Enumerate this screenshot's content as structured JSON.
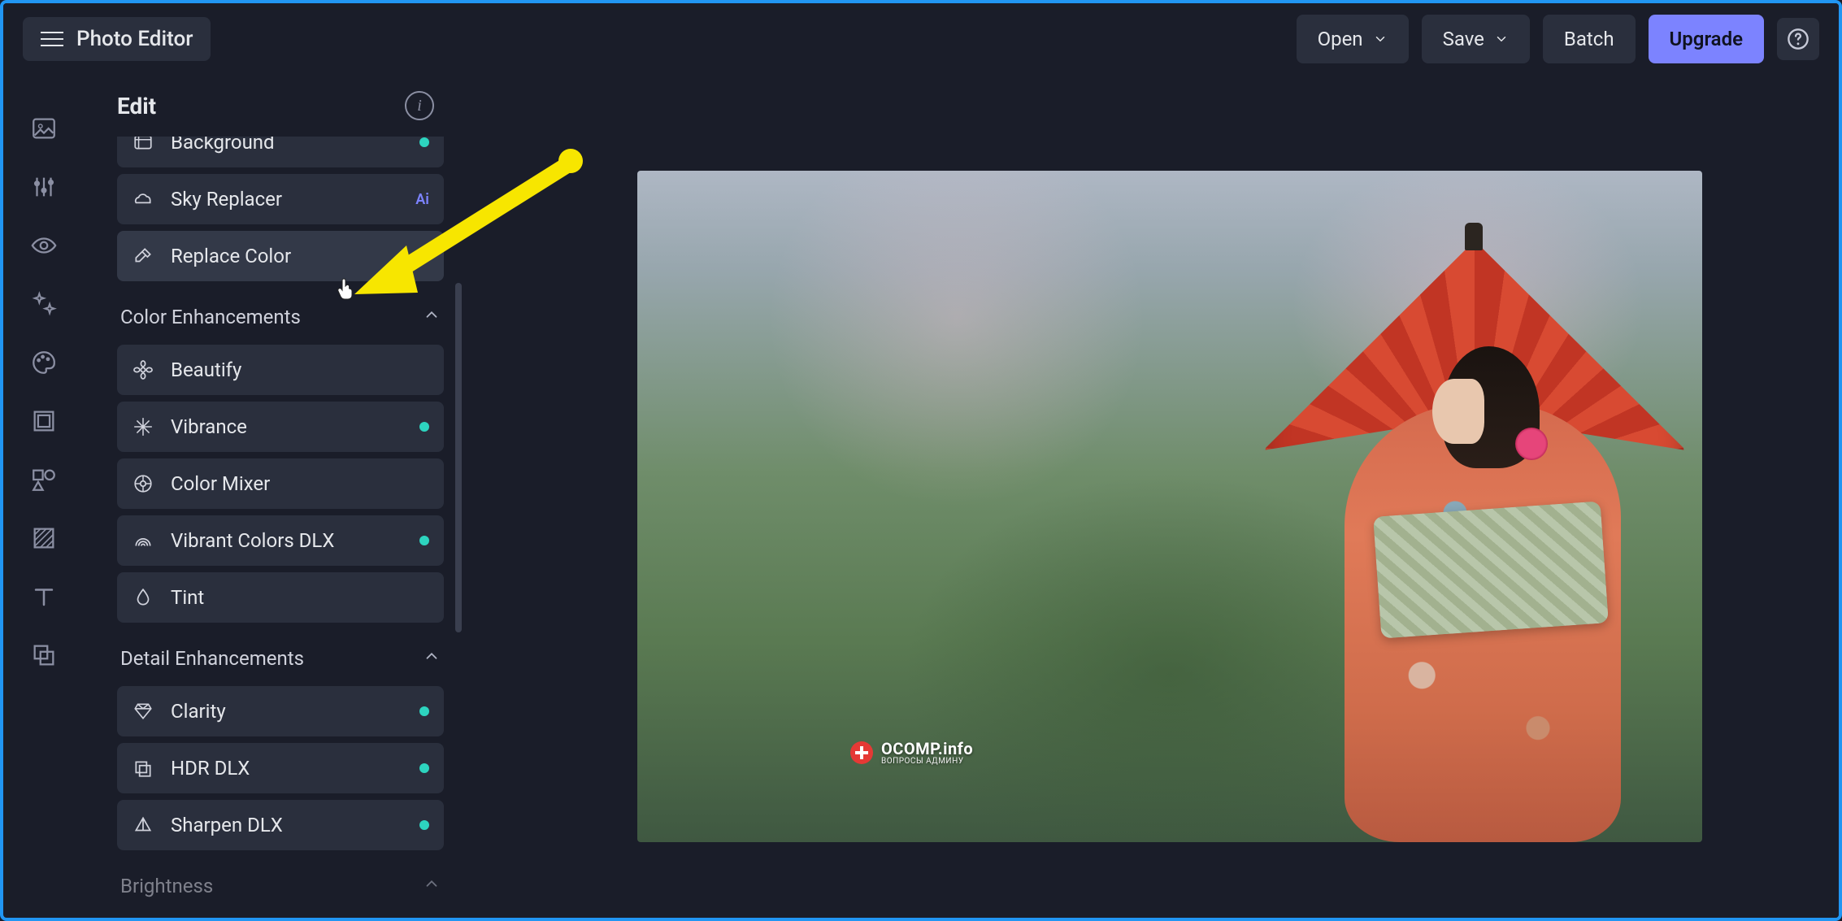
{
  "header": {
    "app_title": "Photo Editor",
    "open_label": "Open",
    "save_label": "Save",
    "batch_label": "Batch",
    "upgrade_label": "Upgrade"
  },
  "panel": {
    "title": "Edit",
    "tools_top": [
      {
        "label": "Background",
        "badge": "dot",
        "icon": "background"
      },
      {
        "label": "Sky Replacer",
        "badge": "ai",
        "icon": "sky"
      },
      {
        "label": "Replace Color",
        "badge": "dot",
        "icon": "eyedropper",
        "selected": true
      }
    ],
    "sections": [
      {
        "title": "Color Enhancements",
        "items": [
          {
            "label": "Beautify",
            "badge": "",
            "icon": "flower"
          },
          {
            "label": "Vibrance",
            "badge": "dot",
            "icon": "sparkle"
          },
          {
            "label": "Color Mixer",
            "badge": "",
            "icon": "wheel"
          },
          {
            "label": "Vibrant Colors DLX",
            "badge": "dot",
            "icon": "rainbow"
          },
          {
            "label": "Tint",
            "badge": "",
            "icon": "drop"
          }
        ]
      },
      {
        "title": "Detail Enhancements",
        "items": [
          {
            "label": "Clarity",
            "badge": "dot",
            "icon": "diamond"
          },
          {
            "label": "HDR DLX",
            "badge": "dot",
            "icon": "layers"
          },
          {
            "label": "Sharpen DLX",
            "badge": "dot",
            "icon": "triangle"
          }
        ]
      },
      {
        "title": "Brightness",
        "items": []
      }
    ]
  },
  "watermark": {
    "main": "OCOMP.info",
    "sub": "ВОПРОСЫ АДМИНУ"
  }
}
